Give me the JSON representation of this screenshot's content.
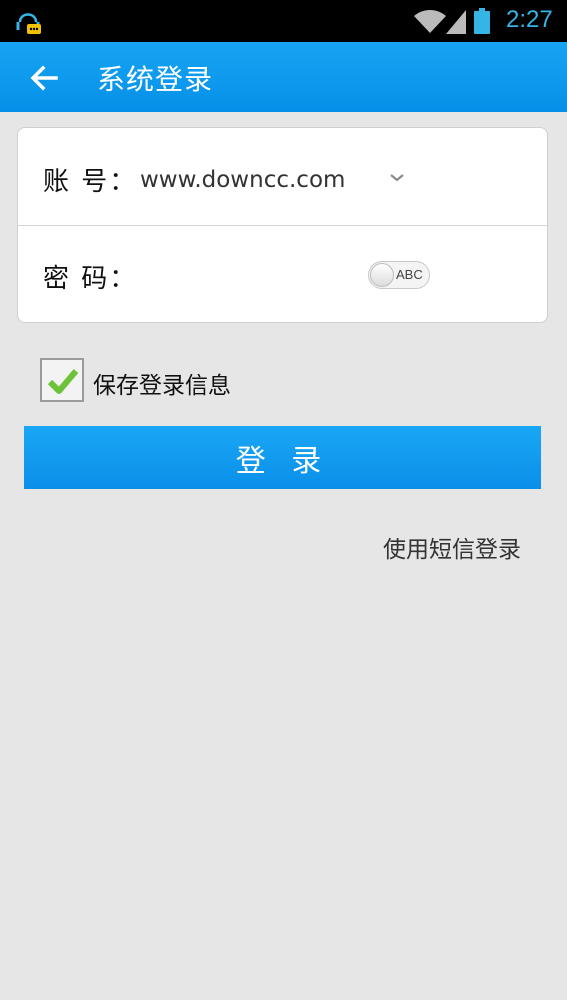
{
  "status_bar": {
    "time": "2:27"
  },
  "header": {
    "title": "系统登录"
  },
  "form": {
    "account_label": "账 号：",
    "account_value": "www.downcc.com",
    "password_label": "密 码：",
    "password_value": "",
    "abc_toggle_label": "ABC"
  },
  "save_login": {
    "label": "保存登录信息",
    "checked": true
  },
  "login_button": {
    "label": "登 录"
  },
  "sms_login": {
    "label": "使用短信登录"
  },
  "colors": {
    "accent": "#0a8fe9",
    "background": "#e6e6e6",
    "status_text": "#35b5e5",
    "check_green": "#6cc33a"
  }
}
